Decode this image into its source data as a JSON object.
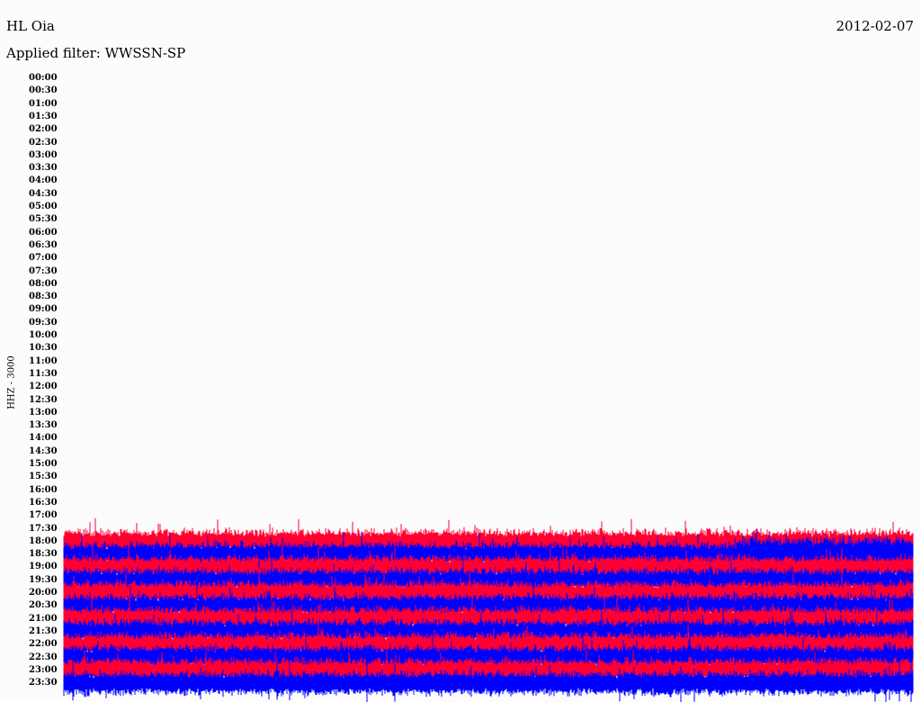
{
  "header": {
    "station": "HL Oia",
    "date": "2012-02-07",
    "filter": "Applied filter: WWSSN-SP"
  },
  "channel_label": "HHZ - 3000",
  "colors": {
    "trace_a": "#ff0033",
    "trace_b": "#0000ff",
    "background": "#fcfcfc"
  },
  "chart_data": {
    "type": "line",
    "title": "HL Oia",
    "ylabel": "HHZ - 3000",
    "row_labels": [
      "00:00",
      "00:30",
      "01:00",
      "01:30",
      "02:00",
      "02:30",
      "03:00",
      "03:30",
      "04:00",
      "04:30",
      "05:00",
      "05:30",
      "06:00",
      "06:30",
      "07:00",
      "07:30",
      "08:00",
      "08:30",
      "09:00",
      "09:30",
      "10:00",
      "10:30",
      "11:00",
      "11:30",
      "12:00",
      "12:30",
      "13:00",
      "13:30",
      "14:00",
      "14:30",
      "15:00",
      "15:30",
      "16:00",
      "16:30",
      "17:00",
      "17:30",
      "18:00",
      "18:30",
      "19:00",
      "19:30",
      "20:00",
      "20:30",
      "21:00",
      "21:30",
      "22:00",
      "22:30",
      "23:00",
      "23:30"
    ],
    "first_row_with_data": "18:00",
    "series": [
      {
        "color": "red",
        "rows": [
          "18:00",
          "19:00",
          "20:00",
          "21:00",
          "22:00",
          "23:00"
        ]
      },
      {
        "color": "blue",
        "rows": [
          "18:30",
          "19:30",
          "20:30",
          "21:30",
          "22:30",
          "23:30"
        ]
      }
    ]
  }
}
